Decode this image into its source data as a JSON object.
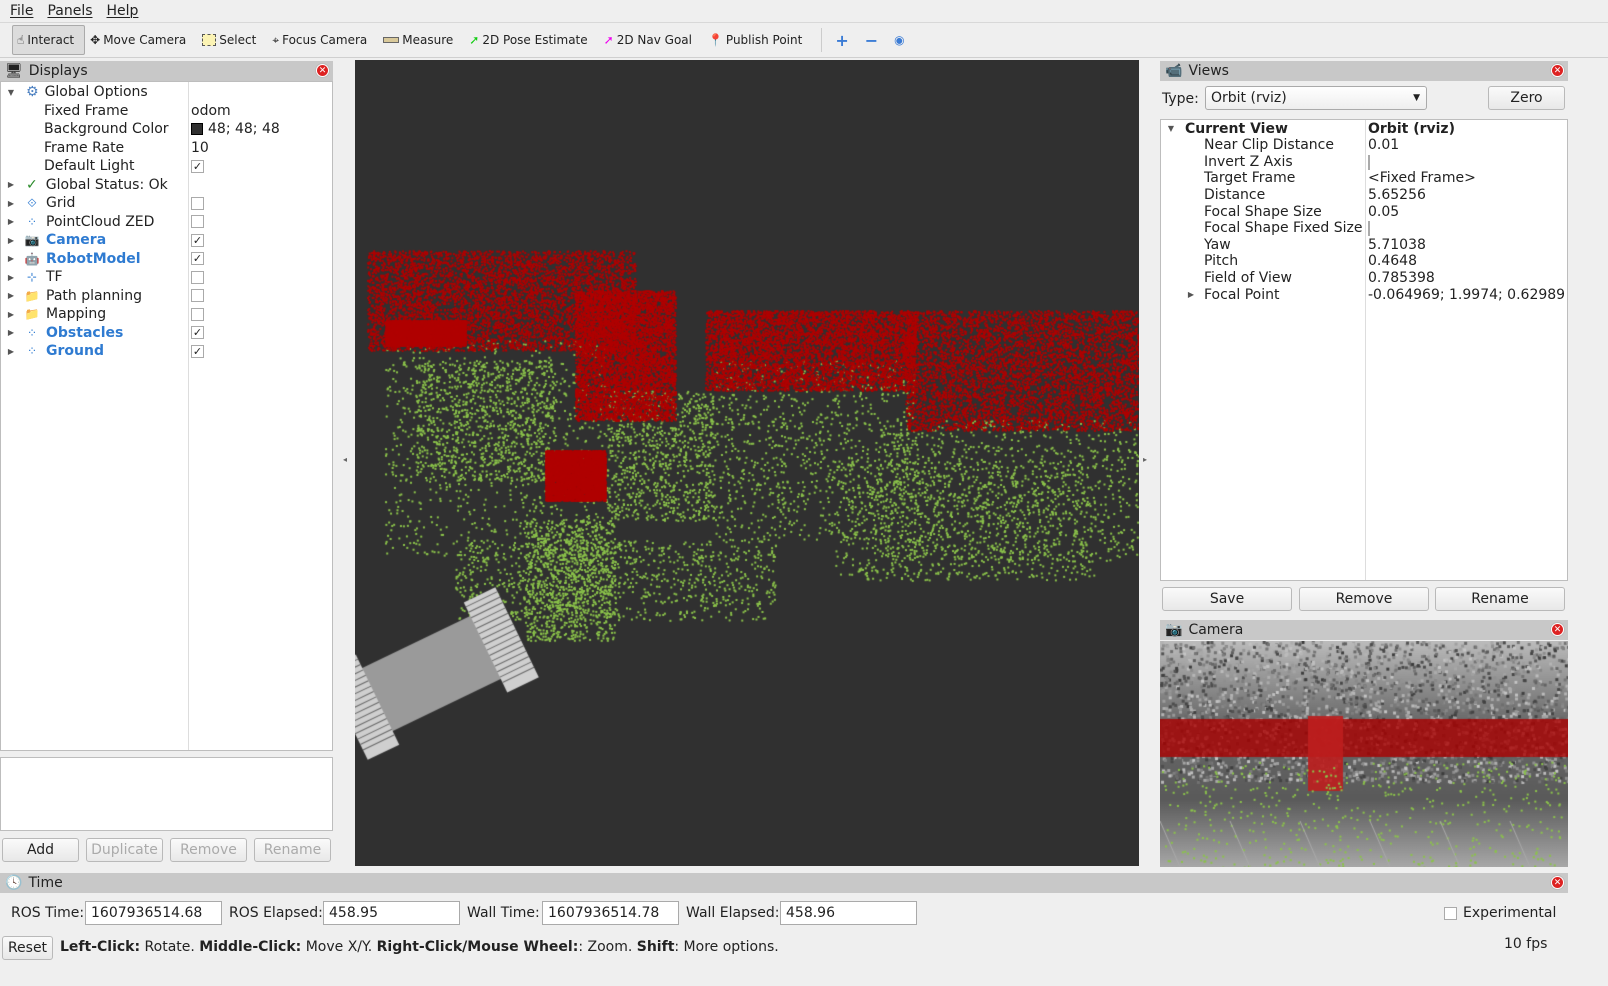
{
  "menu": [
    "File",
    "Panels",
    "Help"
  ],
  "toolbar": {
    "tools": [
      "Interact",
      "Move Camera",
      "Select",
      "Focus Camera",
      "Measure",
      "2D Pose Estimate",
      "2D Nav Goal",
      "Publish Point"
    ]
  },
  "displays": {
    "title": "Displays",
    "global_options": "Global Options",
    "props": [
      {
        "name": "Fixed Frame",
        "value": "odom"
      },
      {
        "name": "Background Color",
        "value": "48; 48; 48"
      },
      {
        "name": "Frame Rate",
        "value": "10"
      },
      {
        "name": "Default Light",
        "checked": true
      }
    ],
    "global_status": "Global Status: Ok",
    "items": [
      {
        "label": "Grid",
        "checked": false,
        "icon": "grid-icon",
        "bold": false
      },
      {
        "label": "PointCloud ZED",
        "checked": false,
        "icon": "pointcloud-icon",
        "bold": false
      },
      {
        "label": "Camera",
        "checked": true,
        "icon": "camera-icon",
        "bold": true
      },
      {
        "label": "RobotModel",
        "checked": true,
        "icon": "robot-icon",
        "bold": true
      },
      {
        "label": "TF",
        "checked": false,
        "icon": "axes-icon",
        "bold": false
      },
      {
        "label": "Path planning",
        "checked": false,
        "icon": "folder-icon",
        "bold": false
      },
      {
        "label": "Mapping",
        "checked": false,
        "icon": "folder-icon",
        "bold": false
      },
      {
        "label": "Obstacles",
        "checked": true,
        "icon": "pointcloud-icon",
        "bold": true
      },
      {
        "label": "Ground",
        "checked": true,
        "icon": "pointcloud-icon",
        "bold": true
      }
    ],
    "buttons": {
      "add": "Add",
      "duplicate": "Duplicate",
      "remove": "Remove",
      "rename": "Rename"
    }
  },
  "views": {
    "title": "Views",
    "type_label": "Type:",
    "type_value": "Orbit (rviz)",
    "zero": "Zero",
    "current_view": "Current View",
    "current_value": "Orbit (rviz)",
    "props": [
      {
        "name": "Near Clip Distance",
        "value": "0.01"
      },
      {
        "name": "Invert Z Axis",
        "checkbox": true
      },
      {
        "name": "Target Frame",
        "value": "<Fixed Frame>"
      },
      {
        "name": "Distance",
        "value": "5.65256"
      },
      {
        "name": "Focal Shape Size",
        "value": "0.05"
      },
      {
        "name": "Focal Shape Fixed Size",
        "checkbox": true
      },
      {
        "name": "Yaw",
        "value": "5.71038"
      },
      {
        "name": "Pitch",
        "value": "0.4648"
      },
      {
        "name": "Field of View",
        "value": "0.785398"
      },
      {
        "name": "Focal Point",
        "value": "-0.064969; 1.9974; 0.62989",
        "expandable": true
      }
    ],
    "buttons": {
      "save": "Save",
      "remove": "Remove",
      "rename": "Rename"
    }
  },
  "camera_panel": {
    "title": "Camera"
  },
  "time": {
    "title": "Time",
    "ros_time_label": "ROS Time:",
    "ros_time": "1607936514.68",
    "ros_elapsed_label": "ROS Elapsed:",
    "ros_elapsed": "458.95",
    "wall_time_label": "Wall Time:",
    "wall_time": "1607936514.78",
    "wall_elapsed_label": "Wall Elapsed:",
    "wall_elapsed": "458.96",
    "experimental": "Experimental"
  },
  "status": {
    "reset": "Reset",
    "k1": "Left-Click:",
    "t1": " Rotate. ",
    "k2": "Middle-Click:",
    "t2": " Move X/Y. ",
    "k3": "Right-Click/Mouse Wheel:",
    "t3": ": Zoom. ",
    "k4": "Shift",
    "t4": ": More options.",
    "fps": "10 fps"
  },
  "colors": {
    "background": "#303030",
    "obstacles": "#b00000",
    "ground": "#8bc34a",
    "accent": "#2f7bd1"
  }
}
